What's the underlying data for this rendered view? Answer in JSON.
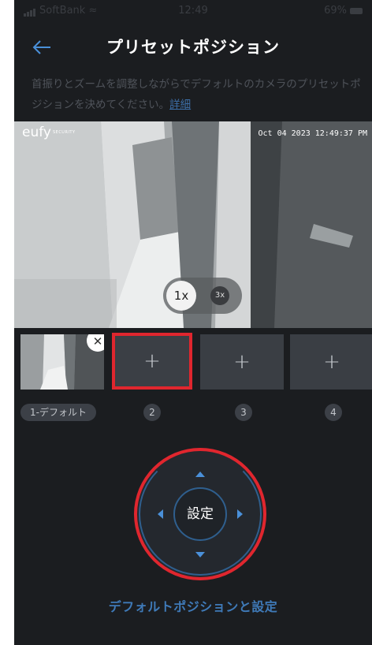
{
  "status_bar": {
    "carrier": "SoftBank",
    "time": "12:49",
    "battery": "69%"
  },
  "header": {
    "title": "プリセットポジション"
  },
  "description": {
    "text": "首振りとズームを調整しながらでデフォルトのカメラのプリセットポジションを決めてください。",
    "link": "詳細"
  },
  "camera": {
    "brand": "eufy",
    "brand_sub": "SECURITY",
    "timestamp": "Oct 04 2023  12:49:37 PM",
    "zoom_options": [
      "1x",
      "3x"
    ],
    "selected_zoom": "1x"
  },
  "presets": {
    "items": [
      {
        "label": "1-デフォルト",
        "has_image": true
      },
      {
        "label": "2",
        "has_image": false,
        "selected": true
      },
      {
        "label": "3",
        "has_image": false
      },
      {
        "label": "4",
        "has_image": false
      }
    ],
    "add_glyph": "+",
    "remove_glyph": "✕"
  },
  "dpad": {
    "center_label": "設定"
  },
  "footer": {
    "default_action": "デフォルトポジションと設定"
  },
  "colors": {
    "background": "#1b1d20",
    "accent": "#4a90d9",
    "highlight": "#e0262e"
  },
  "icons": {
    "back": "arrow-left-icon",
    "wifi": "wifi-icon",
    "battery": "battery-icon"
  }
}
